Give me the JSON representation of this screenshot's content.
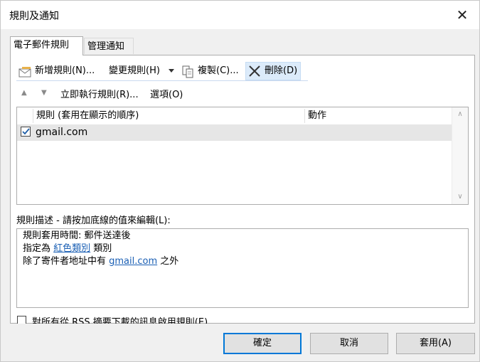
{
  "window": {
    "title": "規則及通知",
    "close_glyph": "✕"
  },
  "tabs": [
    {
      "label": "電子郵件規則",
      "active": true
    },
    {
      "label": "管理通知",
      "active": false
    }
  ],
  "toolbar": {
    "new_rule": "新增規則(N)...",
    "change_rule": "變更規則(H)",
    "copy": "複製(C)...",
    "delete": "刪除(D)",
    "run_rules": "立即執行規則(R)...",
    "options": "選項(O)"
  },
  "rules_list": {
    "columns": [
      "規則 (套用在顯示的順序)",
      "動作"
    ],
    "rows": [
      {
        "name": "gmail.com",
        "checked": true
      }
    ]
  },
  "description": {
    "label": "規則描述 - 請按加底線的值來編輯(L):",
    "line1": "規則套用時間: 郵件送達後",
    "line2_pre": "指定為 ",
    "line2_link": "紅色類別",
    "line2_post": " 類別",
    "line3_pre": "除了寄件者地址中有 ",
    "line3_link": "gmail.com",
    "line3_post": " 之外"
  },
  "rss_option": "對所有從 RSS 摘要下載的訊息啟用規則(E)",
  "buttons": {
    "ok": "確定",
    "cancel": "取消",
    "apply": "套用(A)"
  },
  "colors": {
    "accent": "#0078d7",
    "link": "#1a5fb4",
    "selected_row": "#e6e6e6"
  },
  "icons": [
    "new-rule-icon",
    "dropdown-caret-icon",
    "copy-icon",
    "delete-icon",
    "move-up-icon",
    "move-down-icon",
    "checkbox-checked-icon",
    "close-icon"
  ]
}
